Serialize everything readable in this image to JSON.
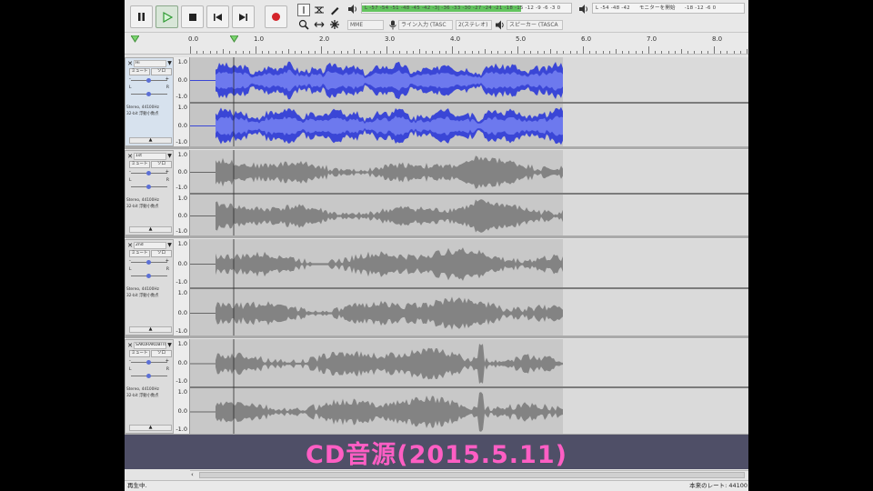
{
  "toolbar": {
    "meter_record_scale": "L  -57  -54  -51  -48  -45  -42  -3|  -36  -33  -30  -27  -24  -21  -18  -15  -12  -9  -6  -3  0",
    "meter_record_level": 0.76,
    "meter_play_prompt": "モニターを開始",
    "meter_play_scale_left": "L   -54   -48   -42",
    "meter_play_scale_right": "-18   -12   -6   0",
    "host": "MME",
    "record_device": "ライン入力 (TASC",
    "channels": "2(ステレオ)",
    "playback_device": "スピーカー (TASCA"
  },
  "ruler": {
    "ticks": [
      "0.0",
      "1.0",
      "2.0",
      "3.0",
      "4.0",
      "5.0",
      "6.0",
      "7.0",
      "8.0"
    ]
  },
  "tracks": [
    {
      "name": "Hi",
      "selected": true,
      "color": "#3a46d6",
      "mute": "ミュート",
      "solo": "ソロ",
      "info1": "Stereo, 44100Hz",
      "info2": "32-bit 浮動小数点",
      "gain_l": "L",
      "gain_r": "R"
    },
    {
      "name": "1st",
      "selected": false,
      "color": "#838383",
      "mute": "ミュート",
      "solo": "ソロ",
      "info1": "Stereo, 44100Hz",
      "info2": "32-bit 浮動小数点",
      "gain_l": "L",
      "gain_r": "R"
    },
    {
      "name": "2nd",
      "selected": false,
      "color": "#838383",
      "mute": "ミュート",
      "solo": "ソロ",
      "info1": "Stereo, 44100Hz",
      "info2": "32-bit 浮動小数点",
      "gain_l": "L",
      "gain_r": "R"
    },
    {
      "name": "SAKURAKOBITO",
      "selected": false,
      "color": "#838383",
      "mute": "ミュート",
      "solo": "ソロ",
      "info1": "Stereo, 44100Hz",
      "info2": "32-bit 浮動小数点",
      "gain_l": "L",
      "gain_r": "R"
    }
  ],
  "vruler": {
    "top": "1.0",
    "mid": "0.0",
    "bot": "-1.0"
  },
  "caption": "CD音源(2015.5.11)",
  "status": {
    "left": "再生中.",
    "right": "本来のレート: 44100"
  },
  "colors": {
    "selected_wave": "#3a46d6",
    "wave": "#838383",
    "caption_text": "#ff5ec4",
    "caption_bg": "#4f4f67"
  }
}
